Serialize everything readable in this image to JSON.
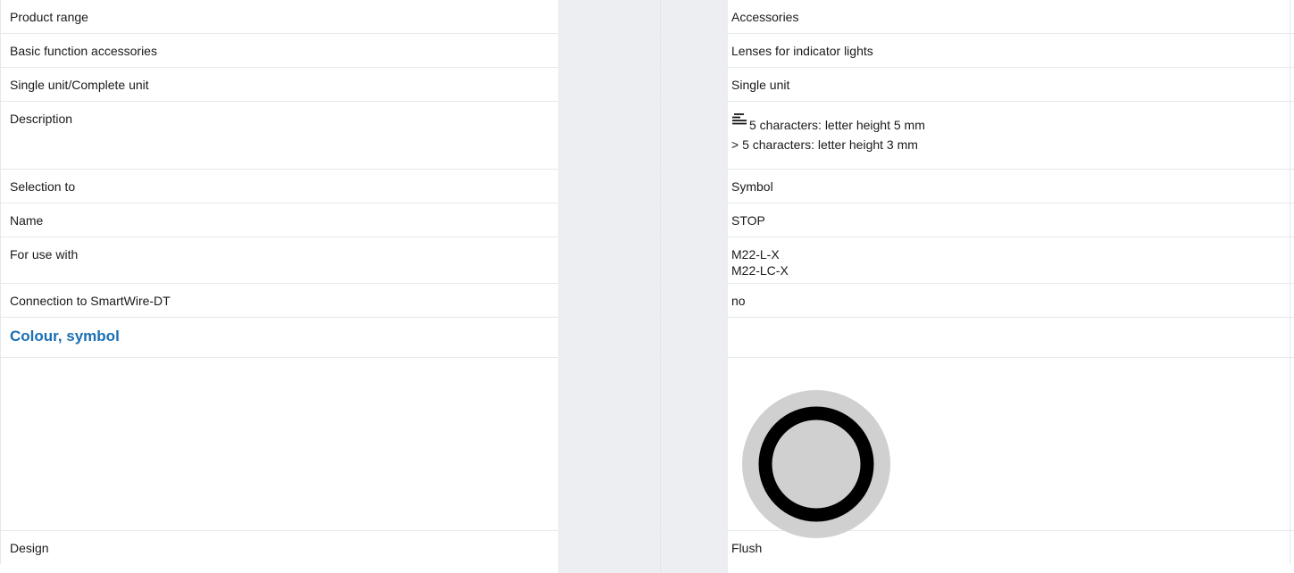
{
  "rows": [
    {
      "label": "Product range",
      "value": "Accessories"
    },
    {
      "label": "Basic function accessories",
      "value": "Lenses for indicator lights"
    },
    {
      "label": "Single unit/Complete unit",
      "value": "Single unit"
    },
    {
      "label": "Description",
      "value_lines": [
        "5 characters: letter height 5 mm",
        "> 5 characters: letter height 3 mm"
      ],
      "icon": "text-lines-icon"
    },
    {
      "label": "Selection to",
      "value": "Symbol"
    },
    {
      "label": "Name",
      "value": "STOP"
    },
    {
      "label": "For use with",
      "value_lines": [
        "M22-L-X",
        "M22-LC-X"
      ]
    },
    {
      "label": "Connection to SmartWire-DT",
      "value": "no"
    }
  ],
  "section": {
    "title": "Colour, symbol"
  },
  "symbol": {
    "icon": "stop-ring-symbol-icon",
    "disc_color": "#d0d0d0",
    "ring_color": "#000000"
  },
  "design": {
    "label": "Design",
    "value": "Flush"
  },
  "colors": {
    "accent": "#1a6fb5",
    "band": "#eceef2",
    "grid": "#e6e8ec"
  }
}
